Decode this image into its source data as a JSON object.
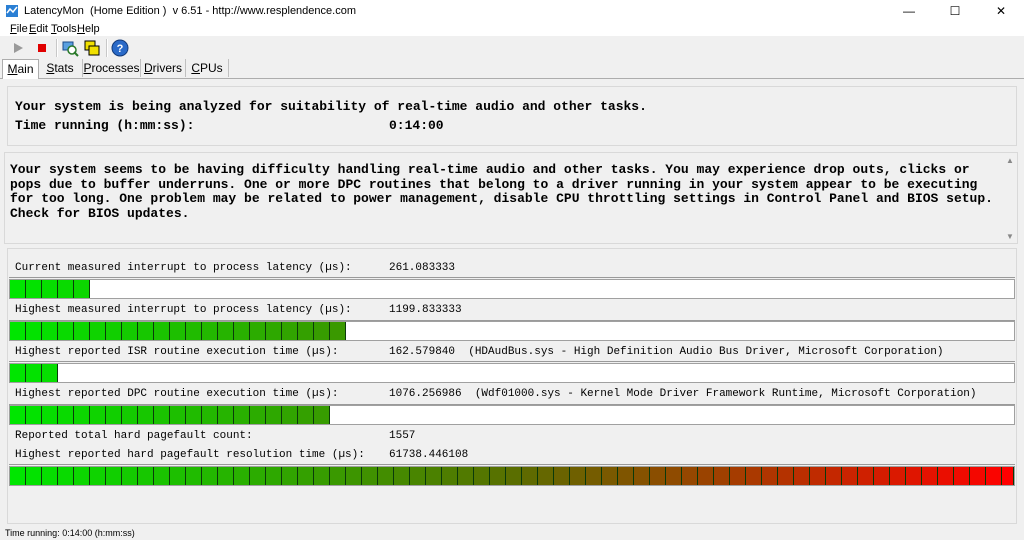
{
  "window": {
    "title": "LatencyMon  (Home Edition )  v 6.51 - http://www.resplendence.com",
    "minimize": "—",
    "maximize": "☐",
    "close": "✕",
    "app_icon": "latencymon-app-icon"
  },
  "menu": {
    "items": [
      {
        "mnemonic": "F",
        "rest": "ile"
      },
      {
        "mnemonic": "E",
        "rest": "dit"
      },
      {
        "mnemonic": "T",
        "rest": "ools"
      },
      {
        "mnemonic": "H",
        "rest": "elp"
      }
    ]
  },
  "toolbar": {
    "icons": [
      "play-icon",
      "stop-icon",
      "view-icon",
      "windows-icon",
      "help-icon"
    ],
    "help_glyph": "?"
  },
  "tabs": [
    {
      "mnemonic": "M",
      "rest": "ain",
      "active": true
    },
    {
      "mnemonic": "S",
      "rest": "tats",
      "active": false
    },
    {
      "mnemonic": "P",
      "rest": "rocesses",
      "active": false
    },
    {
      "mnemonic": "D",
      "rest": "rivers",
      "active": false
    },
    {
      "mnemonic": "C",
      "rest": "PUs",
      "active": false
    }
  ],
  "header": {
    "analysis_text": "Your system is being analyzed for suitability of real-time audio and other tasks.",
    "time_label": "Time running (h:mm:ss):",
    "time_value": "0:14:00"
  },
  "message": {
    "text": "Your system seems to be having difficulty handling real-time audio and other tasks. You may experience drop outs, clicks or pops due to buffer underruns. One or more DPC routines that belong to a driver running in your system appear to be executing for too long. One problem may be related to power management, disable CPU throttling settings in Control Panel and BIOS setup. Check for BIOS updates."
  },
  "metrics": [
    {
      "label": "Current measured interrupt to process latency (µs):",
      "value": "261.083333",
      "detail": "",
      "bar_fraction": 0.074,
      "has_bar": true
    },
    {
      "label": "Highest measured interrupt to process latency (µs):",
      "value": "1199.833333",
      "detail": "",
      "bar_fraction": 0.329,
      "has_bar": true
    },
    {
      "label": "Highest reported ISR routine execution time (µs):",
      "value": "162.579840",
      "detail": "(HDAudBus.sys - High Definition Audio Bus Driver, Microsoft Corporation)",
      "bar_fraction": 0.046,
      "has_bar": true
    },
    {
      "label": "Highest reported DPC routine execution time (µs):",
      "value": "1076.256986",
      "detail": "(Wdf01000.sys - Kernel Mode Driver Framework Runtime, Microsoft Corporation)",
      "bar_fraction": 0.313,
      "has_bar": true
    },
    {
      "label": "Reported total hard pagefault count:",
      "value": "1557",
      "detail": "",
      "bar_fraction": 0,
      "has_bar": false
    },
    {
      "label": "Highest reported hard pagefault resolution time (µs):",
      "value": "61738.446108",
      "detail": "",
      "bar_fraction": 1.0,
      "has_bar": true
    }
  ],
  "status": {
    "text": "Time running: 0:14:00  (h:mm:ss)"
  },
  "colors": {
    "bar_green": "#00e000",
    "bar_olive": "#4a6a00",
    "bar_red": "#ff0000",
    "stop_red": "#e00000"
  }
}
